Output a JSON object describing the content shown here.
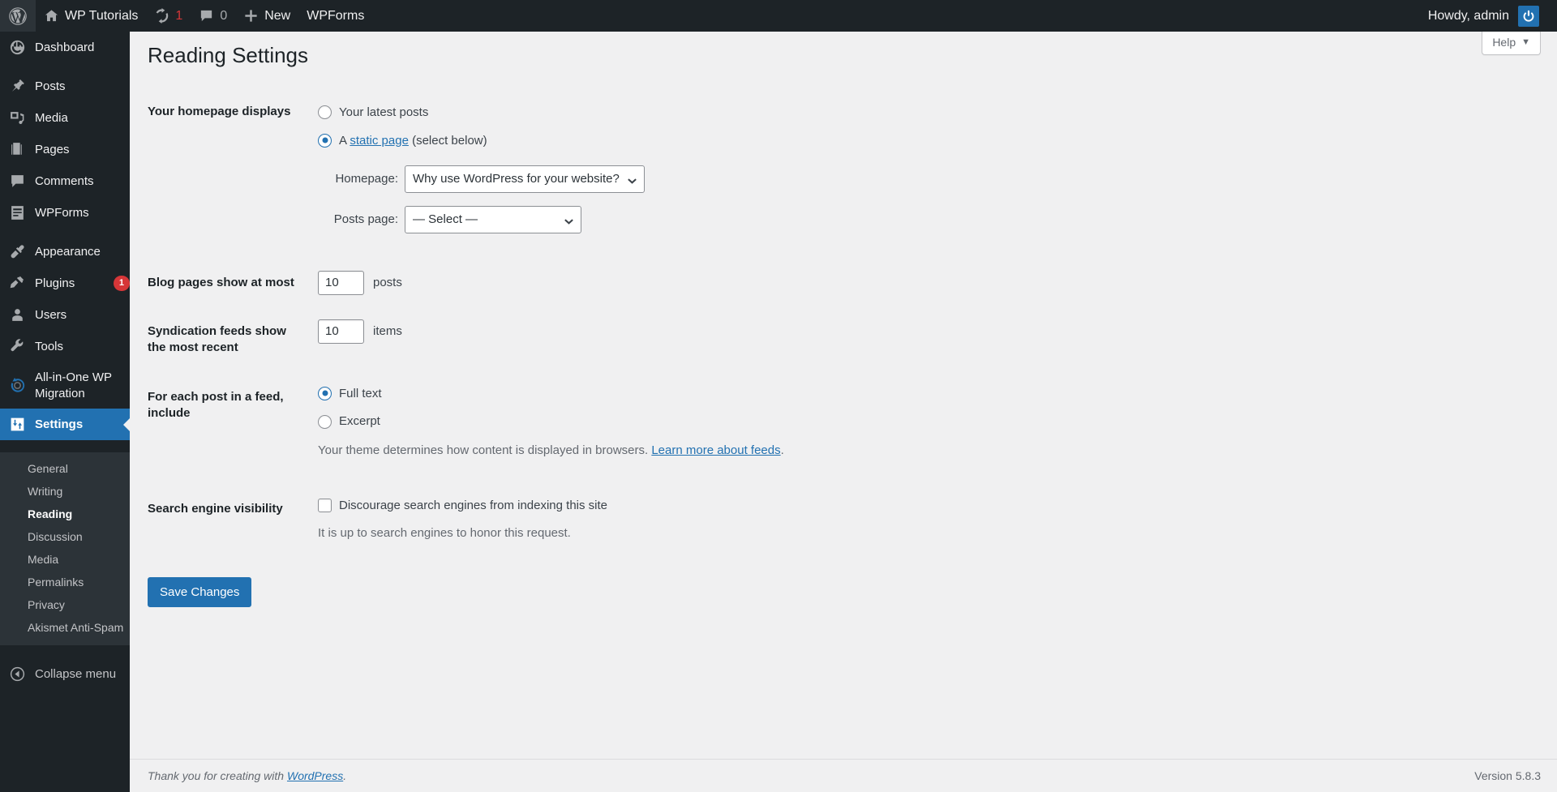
{
  "adminbar": {
    "logo_icon": "wordpress-logo-icon",
    "site_name": "WP Tutorials",
    "site_icon": "home-icon",
    "updates_icon": "updates-icon",
    "updates_count": "1",
    "comments_icon": "comment-bubble-icon",
    "comments_count": "0",
    "new_icon": "plus-icon",
    "new_label": "New",
    "wpforms_label": "WPForms",
    "howdy": "Howdy, admin",
    "avatar_icon": "user-avatar-icon"
  },
  "sidebar": {
    "items": [
      {
        "label": "Dashboard",
        "icon": "dashboard-icon",
        "sep_after": true
      },
      {
        "label": "Posts",
        "icon": "pin-icon"
      },
      {
        "label": "Media",
        "icon": "media-icon"
      },
      {
        "label": "Pages",
        "icon": "pages-icon"
      },
      {
        "label": "Comments",
        "icon": "comments-icon"
      },
      {
        "label": "WPForms",
        "icon": "wpforms-icon",
        "sep_after": true
      },
      {
        "label": "Appearance",
        "icon": "appearance-brush-icon"
      },
      {
        "label": "Plugins",
        "icon": "plugins-plug-icon",
        "badge": "1"
      },
      {
        "label": "Users",
        "icon": "users-icon"
      },
      {
        "label": "Tools",
        "icon": "tools-wrench-icon"
      },
      {
        "label": "All-in-One WP Migration",
        "icon": "migration-icon"
      },
      {
        "label": "Settings",
        "icon": "settings-sliders-icon",
        "current": true
      }
    ],
    "submenu": [
      {
        "label": "General"
      },
      {
        "label": "Writing"
      },
      {
        "label": "Reading",
        "current": true
      },
      {
        "label": "Discussion"
      },
      {
        "label": "Media"
      },
      {
        "label": "Permalinks"
      },
      {
        "label": "Privacy"
      },
      {
        "label": "Akismet Anti-Spam"
      }
    ],
    "collapse": {
      "label": "Collapse menu",
      "icon": "collapse-arrow-icon"
    }
  },
  "content": {
    "help_label": "Help",
    "help_caret": "▼",
    "page_title": "Reading Settings",
    "homepage_row": {
      "label": "Your homepage displays",
      "option_latest": "Your latest posts",
      "option_static_prefix": "A ",
      "option_static_link": "static page",
      "option_static_suffix": " (select below)",
      "latest_checked": false,
      "static_checked": true,
      "homepage_select_label": "Homepage:",
      "homepage_select_value": "Why use WordPress for your website?",
      "postspage_select_label": "Posts page:",
      "postspage_select_value": "— Select —"
    },
    "blog_pages_row": {
      "label": "Blog pages show at most",
      "value": "10",
      "unit": "posts"
    },
    "syndication_row": {
      "label": "Syndication feeds show the most recent",
      "value": "10",
      "unit": "items"
    },
    "feed_row": {
      "label": "For each post in a feed, include",
      "option_full": "Full text",
      "option_excerpt": "Excerpt",
      "full_checked": true,
      "excerpt_checked": false,
      "description_prefix": "Your theme determines how content is displayed in browsers. ",
      "description_link": "Learn more about feeds",
      "description_suffix": "."
    },
    "search_row": {
      "label": "Search engine visibility",
      "checkbox_label": "Discourage search engines from indexing this site",
      "checked": false,
      "description": "It is up to search engines to honor this request."
    },
    "save_label": "Save Changes"
  },
  "footer": {
    "thanks_prefix": "Thank you for creating with ",
    "thanks_link": "WordPress",
    "thanks_suffix": ".",
    "version": "Version 5.8.3"
  },
  "colors": {
    "admin_dark": "#1d2327",
    "admin_darker": "#2c3338",
    "accent_blue": "#2271b1",
    "badge_red": "#d63638",
    "page_bg": "#f0f0f1"
  }
}
